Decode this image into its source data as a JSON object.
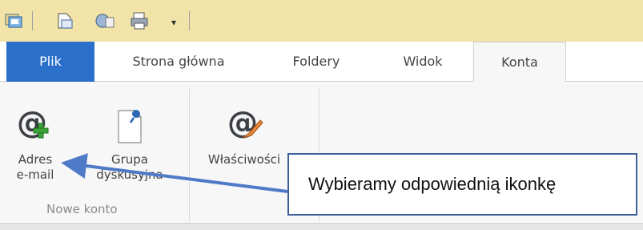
{
  "quick_access_toolbar": {
    "icons": [
      "send-receive-icon",
      "new-item-icon",
      "reply-icon",
      "print-icon"
    ],
    "dropdown_glyph": "▾"
  },
  "tabs": {
    "file": "Plik",
    "home": "Strona główna",
    "folders": "Foldery",
    "view": "Widok",
    "accounts": "Konta"
  },
  "ribbon": {
    "new_account_group": {
      "email_address": {
        "line1": "Adres",
        "line2": "e-mail"
      },
      "newsgroup": {
        "line1": "Grupa",
        "line2": "dyskusyjna"
      },
      "group_label": "Nowe konto"
    },
    "properties": {
      "label": "Właściwości"
    }
  },
  "callout": {
    "text": "Wybieramy odpowiednią ikonkę"
  },
  "colors": {
    "file_tab": "#2a6fc9",
    "toolbar_bg": "#f2e3a8",
    "ribbon_bg": "#f7f7f7",
    "arrow": "#4f7ac7",
    "callout_border": "#3c5f9a"
  }
}
